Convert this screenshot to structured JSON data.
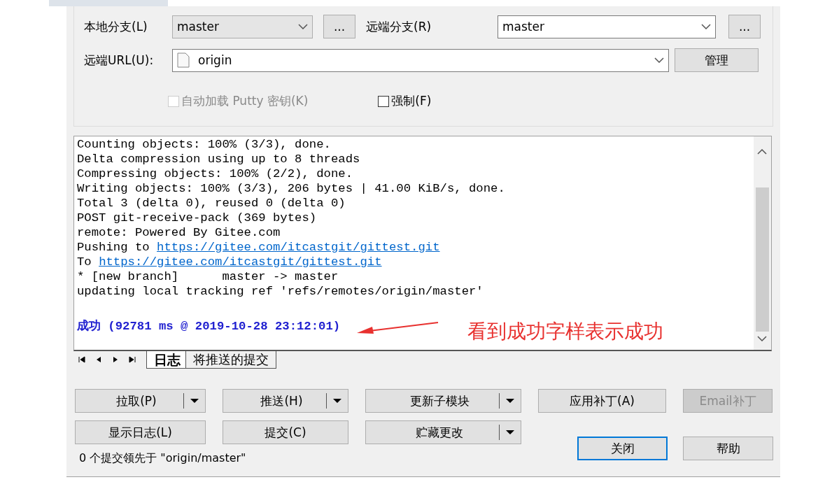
{
  "branches": [
    {
      "label": "本地分支(L)",
      "value": "master",
      "disabled": true,
      "browse": "..."
    },
    {
      "label": "远端分支(R)",
      "value": "master",
      "disabled": false,
      "browse": "..."
    }
  ],
  "remote_url": {
    "label": "远端URL(U):",
    "value": "origin",
    "button": "管理"
  },
  "options": [
    {
      "label": "自动加载 Putty 密钥(K)",
      "checked": false,
      "disabled": true
    },
    {
      "label": "强制(F)",
      "checked": false,
      "disabled": false
    }
  ],
  "log": {
    "lines": [
      {
        "kind": "text",
        "text": "Counting objects: 100% (3/3), done."
      },
      {
        "kind": "text",
        "text": "Delta compression using up to 8 threads"
      },
      {
        "kind": "text",
        "text": "Compressing objects: 100% (2/2), done."
      },
      {
        "kind": "text",
        "text": "Writing objects: 100% (3/3), 206 bytes | 41.00 KiB/s, done."
      },
      {
        "kind": "text",
        "text": "Total 3 (delta 0), reused 0 (delta 0)"
      },
      {
        "kind": "text",
        "text": "POST git-receive-pack (369 bytes)"
      },
      {
        "kind": "text",
        "text": "remote: Powered By Gitee.com"
      },
      {
        "kind": "link",
        "text": "Pushing to ",
        "url": "https://gitee.com/itcastgit/gittest.git"
      },
      {
        "kind": "link",
        "text": "To ",
        "url": "https://gitee.com/itcastgit/gittest.git"
      },
      {
        "kind": "text",
        "text": "* [new branch]      master -> master"
      },
      {
        "kind": "text",
        "text": "updating local tracking ref 'refs/remotes/origin/master'"
      },
      {
        "kind": "blank"
      },
      {
        "kind": "result",
        "text": "成功 (92781 ms @ 2019-10-28 23:12:01)"
      }
    ],
    "annotation": "看到成功字样表示成功"
  },
  "tabs": [
    {
      "label": "日志",
      "selected": true
    },
    {
      "label": "将推送的提交",
      "selected": false
    }
  ],
  "action_buttons": [
    [
      {
        "label": "拉取(P)",
        "kind": "split",
        "disabled": false
      },
      {
        "label": "推送(H)",
        "kind": "split",
        "disabled": false
      },
      {
        "label": "更新子模块",
        "kind": "split",
        "disabled": false
      },
      {
        "label": "应用补丁(A)",
        "kind": "plain",
        "disabled": false
      },
      {
        "label": "Email补丁",
        "kind": "plain",
        "disabled": true
      }
    ],
    [
      {
        "label": "显示日志(L)",
        "kind": "plain",
        "disabled": false
      },
      {
        "label": "提交(C)",
        "kind": "plain",
        "disabled": false
      },
      {
        "label": "贮藏更改",
        "kind": "split",
        "disabled": false
      }
    ]
  ],
  "status": "0 个提交领先于 \"origin/master\"",
  "dialog_buttons": [
    {
      "label": "关闭",
      "default": true
    },
    {
      "label": "帮助",
      "default": false
    }
  ]
}
